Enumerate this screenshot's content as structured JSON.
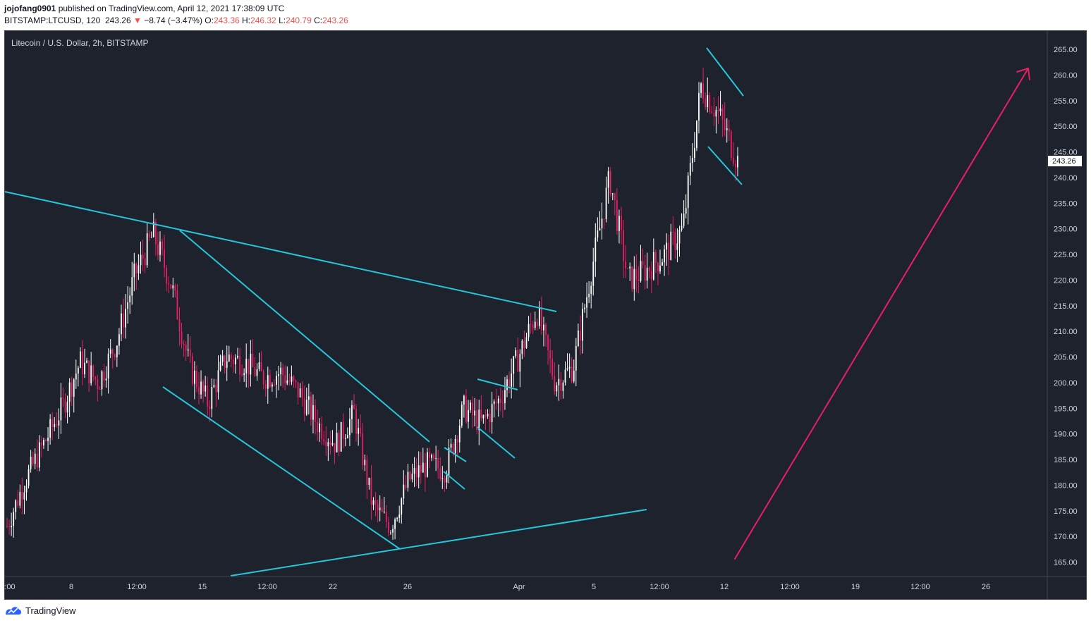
{
  "header": {
    "author": "jojofang0901",
    "published_text": "published on TradingView.com, April 12, 2021 17:38:09 UTC",
    "symbol": "BITSTAMP:LTCUSD, 120",
    "last_price": "243.26",
    "change_arrow": "▼",
    "change": "−8.74 (−3.47%)",
    "o_label": "O:",
    "o_value": "243.36",
    "h_label": "H:",
    "h_value": "246.32",
    "l_label": "L:",
    "l_value": "240.79",
    "c_label": "C:",
    "c_value": "243.26"
  },
  "legend": {
    "title": "Litecoin / U.S. Dollar, 2h, BITSTAMP"
  },
  "price_axis": {
    "labels": [
      "265.00",
      "260.00",
      "255.00",
      "250.00",
      "245.00",
      "240.00",
      "235.00",
      "230.00",
      "225.00",
      "220.00",
      "215.00",
      "210.00",
      "205.00",
      "200.00",
      "195.00",
      "190.00",
      "185.00",
      "180.00",
      "175.00",
      "170.00",
      "165.00"
    ],
    "last_price_tag": "243.26"
  },
  "time_axis": {
    "labels": [
      ":00",
      "8",
      "12:00",
      "15",
      "12:00",
      "22",
      "26",
      "Apr",
      "5",
      "12:00",
      "12",
      "12:00",
      "19",
      "12:00",
      "26"
    ]
  },
  "footer": {
    "brand": "TradingView"
  },
  "colors": {
    "background": "#1e222d",
    "trendline": "#26c6da",
    "projection_arrow": "#e91e63",
    "candle_up": "#ffffff",
    "candle_down": "#e91e63"
  },
  "chart_data": {
    "type": "candlestick",
    "symbol": "BITSTAMP:LTCUSD",
    "interval": "2h",
    "y_range": [
      162,
      268
    ],
    "path_points": [
      {
        "x": "Mar 5",
        "y": 172
      },
      {
        "x": "Mar 7",
        "y": 181
      },
      {
        "x": "Mar 8",
        "y": 188
      },
      {
        "x": "Mar 9",
        "y": 195
      },
      {
        "x": "Mar 10",
        "y": 204
      },
      {
        "x": "Mar 11",
        "y": 200
      },
      {
        "x": "Mar 12",
        "y": 208
      },
      {
        "x": "Mar 13",
        "y": 221
      },
      {
        "x": "Mar 14",
        "y": 229
      },
      {
        "x": "Mar 15",
        "y": 219
      },
      {
        "x": "Mar 16",
        "y": 203
      },
      {
        "x": "Mar 17",
        "y": 196
      },
      {
        "x": "Mar 18",
        "y": 205
      },
      {
        "x": "Mar 19",
        "y": 204
      },
      {
        "x": "Mar 20",
        "y": 201
      },
      {
        "x": "Mar 21",
        "y": 202
      },
      {
        "x": "Mar 22",
        "y": 198
      },
      {
        "x": "Mar 23",
        "y": 192
      },
      {
        "x": "Mar 24",
        "y": 188
      },
      {
        "x": "Mar 25",
        "y": 194
      },
      {
        "x": "Mar 25 12:00",
        "y": 176
      },
      {
        "x": "Mar 26",
        "y": 172
      },
      {
        "x": "Mar 27",
        "y": 181
      },
      {
        "x": "Mar 28",
        "y": 184
      },
      {
        "x": "Mar 29",
        "y": 183
      },
      {
        "x": "Mar 30",
        "y": 195
      },
      {
        "x": "Mar 31",
        "y": 192
      },
      {
        "x": "Apr 1",
        "y": 197
      },
      {
        "x": "Apr 2",
        "y": 205
      },
      {
        "x": "Apr 3",
        "y": 214
      },
      {
        "x": "Apr 4",
        "y": 200
      },
      {
        "x": "Apr 5",
        "y": 203
      },
      {
        "x": "Apr 6",
        "y": 222
      },
      {
        "x": "Apr 7",
        "y": 240
      },
      {
        "x": "Apr 7 12:00",
        "y": 220
      },
      {
        "x": "Apr 8",
        "y": 222
      },
      {
        "x": "Apr 9",
        "y": 225
      },
      {
        "x": "Apr 10",
        "y": 230
      },
      {
        "x": "Apr 11",
        "y": 258
      },
      {
        "x": "Apr 11 12:00",
        "y": 252
      },
      {
        "x": "Apr 12",
        "y": 243.26
      }
    ],
    "annotations": {
      "trendlines": 9,
      "projection_arrow_target": 261
    }
  }
}
